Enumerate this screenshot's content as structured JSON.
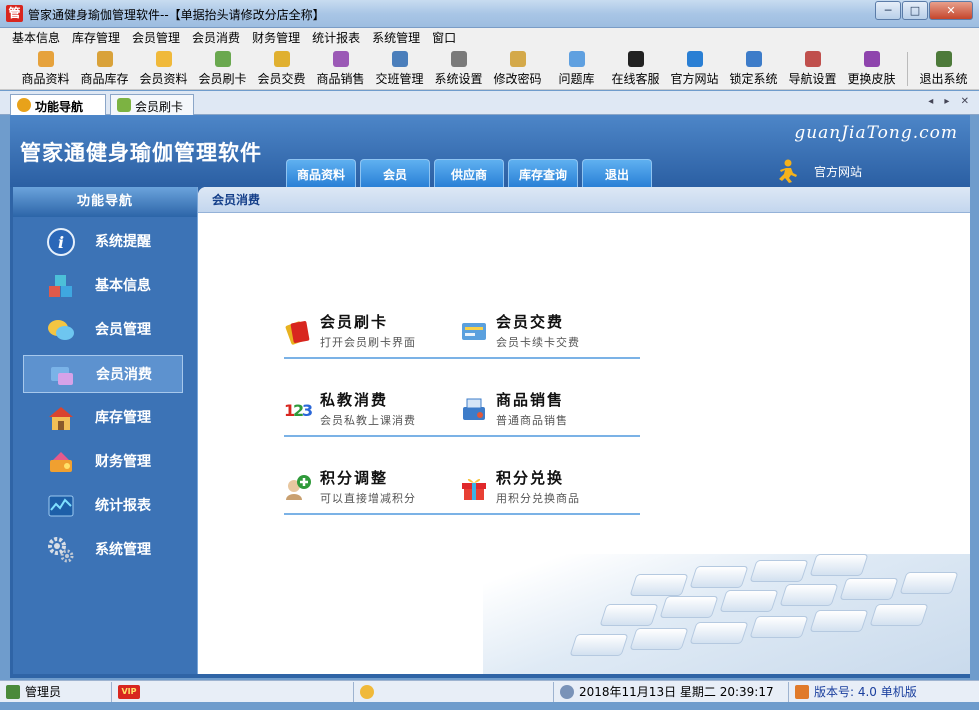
{
  "window": {
    "title": "管家通健身瑜伽管理软件--【单据抬头请修改分店全称】",
    "app_icon_glyph": "管",
    "minimize": "─",
    "maximize": "□",
    "close": "✕"
  },
  "menubar": [
    "基本信息",
    "库存管理",
    "会员管理",
    "会员消费",
    "财务管理",
    "统计报表",
    "系统管理",
    "窗口"
  ],
  "toolbar": [
    {
      "label": "商品资料",
      "icon": "goods-icon",
      "color": "#e6a23c"
    },
    {
      "label": "商品库存",
      "icon": "inventory-icon",
      "color": "#d9a23a"
    },
    {
      "label": "会员资料",
      "icon": "member-icon",
      "color": "#f0b93a"
    },
    {
      "label": "会员刷卡",
      "icon": "card-icon",
      "color": "#6aa84f"
    },
    {
      "label": "会员交费",
      "icon": "payment-icon",
      "color": "#e0b030"
    },
    {
      "label": "商品销售",
      "icon": "sales-icon",
      "color": "#9b59b6"
    },
    {
      "label": "交班管理",
      "icon": "shift-icon",
      "color": "#4a7ebb"
    },
    {
      "label": "系统设置",
      "icon": "settings-icon",
      "color": "#7a7a7a"
    },
    {
      "label": "修改密码",
      "icon": "password-icon",
      "color": "#d4a94a"
    },
    {
      "label": "问题库",
      "icon": "question-icon",
      "color": "#5fa0e0"
    },
    {
      "label": "在线客服",
      "icon": "qq-icon",
      "color": "#222222"
    },
    {
      "label": "官方网站",
      "icon": "ie-icon",
      "color": "#2a7fd4"
    },
    {
      "label": "锁定系统",
      "icon": "lock-icon",
      "color": "#3d7cc9"
    },
    {
      "label": "导航设置",
      "icon": "nav-settings-icon",
      "color": "#c0504d"
    },
    {
      "label": "更换皮肤",
      "icon": "skin-icon",
      "color": "#8e44ad"
    },
    {
      "label": "退出系统",
      "icon": "exit-icon",
      "color": "#4d7a3a"
    }
  ],
  "tabs": [
    {
      "label": "功能导航",
      "active": true
    },
    {
      "label": "会员刷卡",
      "active": false
    }
  ],
  "tabnav": "◂ ▸ ✕",
  "header": {
    "title": "管家通健身瑜伽管理软件",
    "brand": "guanJiaTong.com",
    "tabs": [
      "商品资料",
      "会员",
      "供应商",
      "库存查询",
      "退出"
    ],
    "official_site": "官方网站"
  },
  "leftnav": {
    "heading": "功能导航",
    "items": [
      {
        "label": "系统提醒",
        "icon": "info-icon",
        "active": false
      },
      {
        "label": "基本信息",
        "icon": "cubes-icon",
        "active": false
      },
      {
        "label": "会员管理",
        "icon": "members-icon",
        "active": false
      },
      {
        "label": "会员消费",
        "icon": "consume-icon",
        "active": true
      },
      {
        "label": "库存管理",
        "icon": "warehouse-icon",
        "active": false
      },
      {
        "label": "财务管理",
        "icon": "finance-icon",
        "active": false
      },
      {
        "label": "统计报表",
        "icon": "chart-icon",
        "active": false
      },
      {
        "label": "系统管理",
        "icon": "gears-icon",
        "active": false
      }
    ]
  },
  "content": {
    "breadcrumb": "会员消费",
    "actions": [
      {
        "name": "会员刷卡",
        "desc": "打开会员刷卡界面",
        "icon": "card-swipe-icon"
      },
      {
        "name": "会员交费",
        "desc": "会员卡续卡交费",
        "icon": "renew-icon"
      },
      {
        "name": "私教消费",
        "desc": "会员私教上课消费",
        "icon": "numbers-123-icon"
      },
      {
        "name": "商品销售",
        "desc": "普通商品销售",
        "icon": "cash-register-icon"
      },
      {
        "name": "积分调整",
        "desc": "可以直接增减积分",
        "icon": "points-adjust-icon"
      },
      {
        "name": "积分兑换",
        "desc": "用积分兑换商品",
        "icon": "gift-icon"
      }
    ]
  },
  "statusbar": {
    "user": "管理员",
    "vip": "VIP",
    "datetime": "2018年11月13日 星期二   20:39:17",
    "version": "版本号: 4.0 单机版"
  }
}
